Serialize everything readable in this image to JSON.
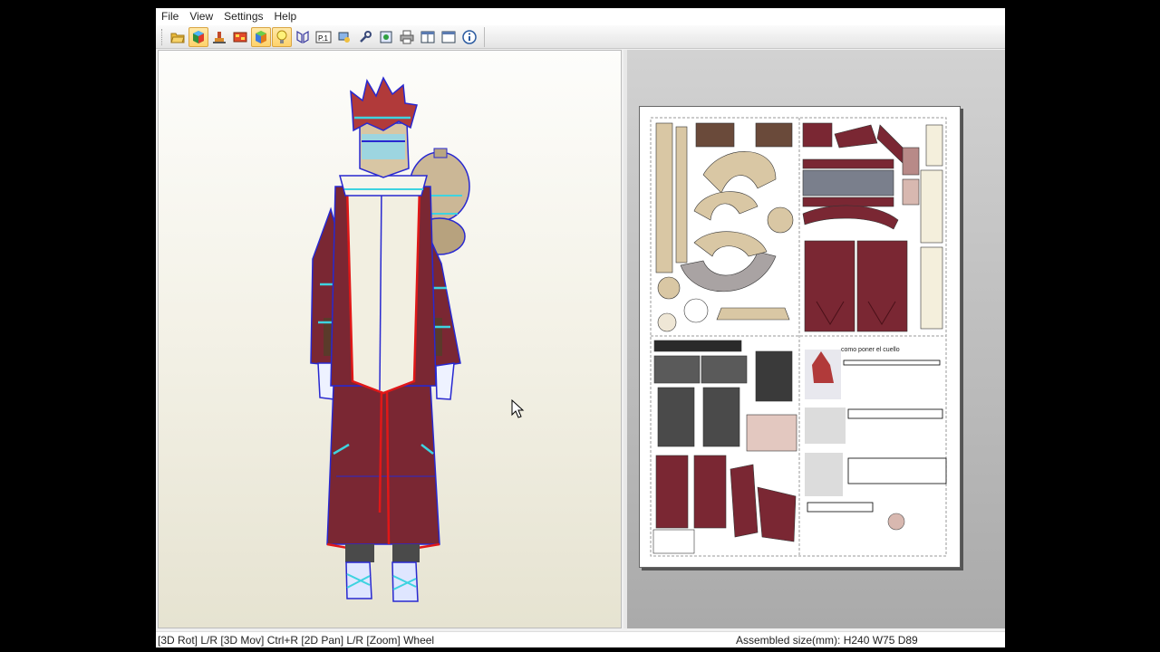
{
  "menu": {
    "file": "File",
    "view": "View",
    "settings": "Settings",
    "help": "Help"
  },
  "toolbar": {
    "buttons": [
      "open-icon",
      "cube-icon",
      "unfold-icon",
      "texture-icon",
      "model-view-icon",
      "light-bulb-icon",
      "edge-icon",
      "page-number-icon",
      "settings-icon",
      "wrench-icon",
      "export-icon",
      "print-icon",
      "split-view-icon",
      "single-view-icon",
      "info-icon"
    ],
    "active": [
      "cube-icon",
      "model-view-icon",
      "light-bulb-icon"
    ],
    "page_icon_label": "P.1"
  },
  "pattern_sheet": {
    "note": "como poner el cuello"
  },
  "status": {
    "controls": "[3D Rot] L/R [3D Mov] Ctrl+R [2D Pan] L/R [Zoom] Wheel",
    "assembled_size": "Assembled size(mm): H240 W75 D89"
  },
  "colors": {
    "robe": "#7a2733",
    "skin": "#d8c6a4",
    "outline": "#2828d0",
    "highlight": "#3ed3e0",
    "selection": "#e01818"
  }
}
